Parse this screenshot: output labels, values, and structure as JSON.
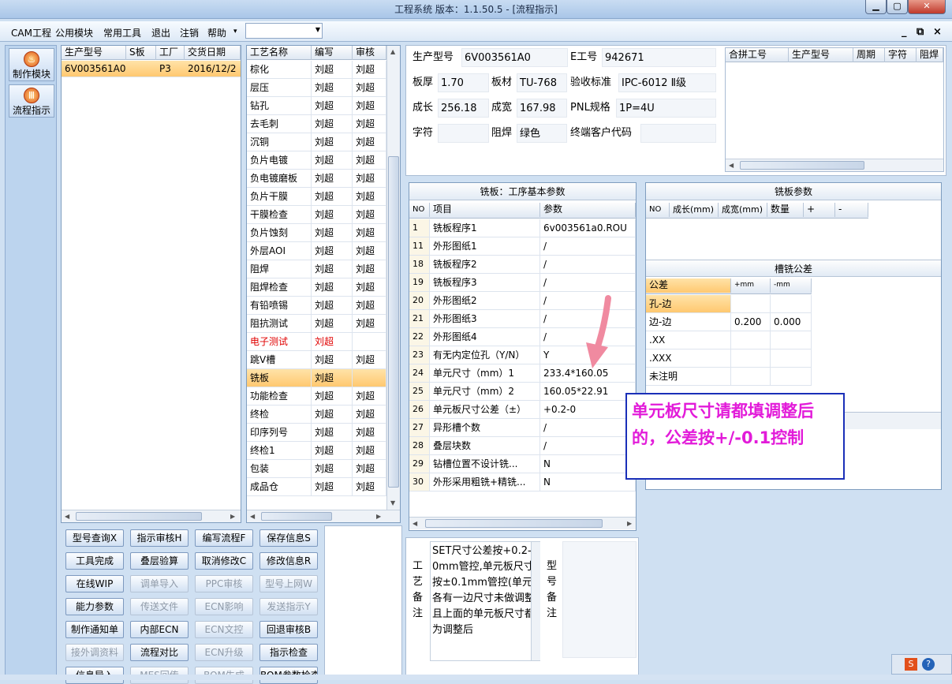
{
  "window": {
    "title": "工程系统   版本：1.1.50.5 - [流程指示]"
  },
  "menu": {
    "items": [
      "CAM工程",
      "公用模块",
      "常用工具",
      "退出",
      "注销",
      "帮助"
    ],
    "help_arrow": "▾",
    "combo_value": "",
    "mdi": [
      "_",
      "ꟷ",
      "×"
    ]
  },
  "nav": {
    "make": "制作模块",
    "flow": "流程指示"
  },
  "orders": {
    "headers": [
      "生产型号",
      "S板",
      "工厂",
      "交货日期"
    ],
    "row": [
      "6V003561A0",
      "",
      "P3",
      "2016/12/2"
    ]
  },
  "process": {
    "headers": [
      "工艺名称",
      "编写",
      "审核"
    ],
    "rows": [
      [
        "棕化",
        "刘超",
        "刘超"
      ],
      [
        "层压",
        "刘超",
        "刘超"
      ],
      [
        "钻孔",
        "刘超",
        "刘超"
      ],
      [
        "去毛刺",
        "刘超",
        "刘超"
      ],
      [
        "沉铜",
        "刘超",
        "刘超"
      ],
      [
        "负片电镀",
        "刘超",
        "刘超"
      ],
      [
        "负电镀磨板",
        "刘超",
        "刘超"
      ],
      [
        "负片干膜",
        "刘超",
        "刘超"
      ],
      [
        "干膜检查",
        "刘超",
        "刘超"
      ],
      [
        "负片蚀刻",
        "刘超",
        "刘超"
      ],
      [
        "外层AOI",
        "刘超",
        "刘超"
      ],
      [
        "阻焊",
        "刘超",
        "刘超"
      ],
      [
        "阻焊检查",
        "刘超",
        "刘超"
      ],
      [
        "有铅喷锡",
        "刘超",
        "刘超"
      ],
      [
        "阻抗测试",
        "刘超",
        "刘超"
      ],
      [
        "电子测试",
        "刘超",
        ""
      ],
      [
        "跳V槽",
        "刘超",
        "刘超"
      ],
      [
        "铣板",
        "刘超",
        ""
      ],
      [
        "功能检查",
        "刘超",
        "刘超"
      ],
      [
        "终检",
        "刘超",
        "刘超"
      ],
      [
        "印序列号",
        "刘超",
        "刘超"
      ],
      [
        "终检1",
        "刘超",
        "刘超"
      ],
      [
        "包装",
        "刘超",
        "刘超"
      ],
      [
        "成品仓",
        "刘超",
        "刘超"
      ]
    ],
    "selected": 17,
    "red": 15
  },
  "buttons": [
    [
      "型号查询X",
      "指示审核H",
      "编写流程F",
      "保存信息S"
    ],
    [
      "工具完成",
      "叠层验算",
      "取消修改C",
      "修改信息R"
    ],
    [
      "在线WIP",
      "调单导入",
      "PPC审核",
      "型号上网W"
    ],
    [
      "能力参数",
      "传送文件",
      "ECN影响",
      "发送指示Y"
    ],
    [
      "制作通知单",
      "内部ECN",
      "ECN文控",
      "回退审核B"
    ],
    [
      "接外调资料",
      "流程对比",
      "ECN升级",
      "指示检查"
    ],
    [
      "信息导入",
      "MES回传",
      "BOM生成",
      "BOM参数检查"
    ]
  ],
  "buttons_disabled": [
    "调单导入",
    "PPC审核",
    "型号上网W",
    "传送文件",
    "ECN影响",
    "发送指示Y",
    "ECN文控",
    "接外调资料",
    "ECN升级",
    "MES回传",
    "BOM生成"
  ],
  "info": {
    "model_label": "生产型号",
    "model": "6V003561A0",
    "eng_label": "E工号",
    "eng": "942671",
    "thick_label": "板厚",
    "thick": "1.70",
    "mat_label": "板材",
    "mat": "TU-768",
    "std_label": "验收标准",
    "std": "IPC-6012 Ⅱ级",
    "len_label": "成长",
    "len": "256.18",
    "wid_label": "成宽",
    "wid": "167.98",
    "pnl_label": "PNL规格",
    "pnl": "1P=4U",
    "char_label": "字符",
    "char": "",
    "mask_label": "阻焊",
    "mask": "绿色",
    "cust_label": "终端客户代码",
    "cust": ""
  },
  "merge": {
    "headers": [
      "合拼工号",
      "生产型号",
      "周期",
      "字符",
      "阻焊"
    ]
  },
  "mill": {
    "title": "铣板：工序基本参数",
    "headers": [
      "NO",
      "项目",
      "参数"
    ],
    "rows": [
      [
        "1",
        "铣板程序1",
        "6v003561a0.ROU"
      ],
      [
        "11",
        "外形图纸1",
        "/"
      ],
      [
        "18",
        "铣板程序2",
        "/"
      ],
      [
        "19",
        "铣板程序3",
        "/"
      ],
      [
        "20",
        "外形图纸2",
        "/"
      ],
      [
        "21",
        "外形图纸3",
        "/"
      ],
      [
        "22",
        "外形图纸4",
        "/"
      ],
      [
        "23",
        "有无内定位孔（Y/N）",
        "Y"
      ],
      [
        "24",
        "单元尺寸（mm）1",
        "233.4*160.05"
      ],
      [
        "25",
        "单元尺寸（mm）2",
        "160.05*22.91"
      ],
      [
        "26",
        "单元板尺寸公差（±）",
        "+0.2-0"
      ],
      [
        "27",
        "异形槽个数",
        "/"
      ],
      [
        "28",
        "叠层块数",
        "/"
      ],
      [
        "29",
        "钻槽位置不设计铣...",
        "N"
      ],
      [
        "30",
        "外形采用粗铣+精铣...",
        "N"
      ]
    ]
  },
  "millparams": {
    "title": "铣板参数",
    "headers": [
      "NO",
      "成长(mm)",
      "成宽(mm)",
      "数量",
      "+",
      "-"
    ]
  },
  "slot": {
    "title": "槽铣公差",
    "headers": [
      "公差",
      "+mm",
      "-mm"
    ],
    "rows": [
      [
        "孔-边",
        "",
        ""
      ],
      [
        "边-边",
        "0.200",
        "0.000"
      ],
      [
        ".XX",
        "",
        ""
      ],
      [
        ".XXX",
        "",
        ""
      ],
      [
        "未注明",
        "",
        ""
      ]
    ]
  },
  "notes": {
    "proc_label": "工艺备注",
    "text": "SET尺寸公差按+0.2-0mm管控,单元板尺寸按±0.1mm管控(单元各有一边尺寸未做调整且上面的单元板尺寸都为调整后",
    "model_label": "型号备注"
  },
  "callout": {
    "text": "单元板尺寸请都填调整后的，公差按+/-0.1控制",
    "color": "#e21bd9"
  },
  "tray": {
    "s": "S",
    "help": "?"
  }
}
